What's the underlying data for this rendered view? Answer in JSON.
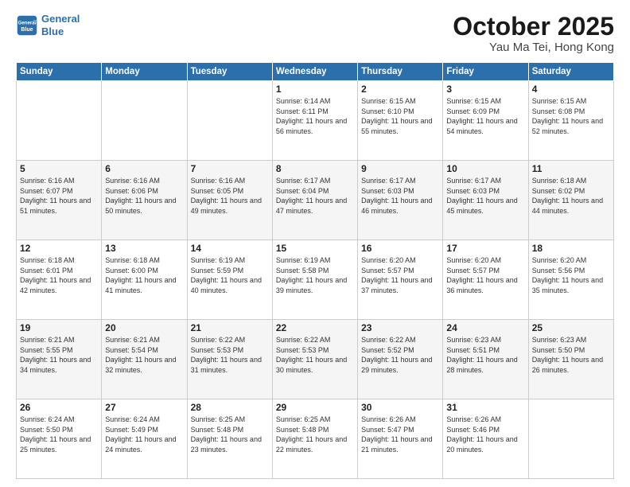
{
  "header": {
    "logo_line1": "General",
    "logo_line2": "Blue",
    "month": "October 2025",
    "location": "Yau Ma Tei, Hong Kong"
  },
  "weekdays": [
    "Sunday",
    "Monday",
    "Tuesday",
    "Wednesday",
    "Thursday",
    "Friday",
    "Saturday"
  ],
  "weeks": [
    [
      {
        "day": "",
        "sunrise": "",
        "sunset": "",
        "daylight": ""
      },
      {
        "day": "",
        "sunrise": "",
        "sunset": "",
        "daylight": ""
      },
      {
        "day": "",
        "sunrise": "",
        "sunset": "",
        "daylight": ""
      },
      {
        "day": "1",
        "sunrise": "Sunrise: 6:14 AM",
        "sunset": "Sunset: 6:11 PM",
        "daylight": "Daylight: 11 hours and 56 minutes."
      },
      {
        "day": "2",
        "sunrise": "Sunrise: 6:15 AM",
        "sunset": "Sunset: 6:10 PM",
        "daylight": "Daylight: 11 hours and 55 minutes."
      },
      {
        "day": "3",
        "sunrise": "Sunrise: 6:15 AM",
        "sunset": "Sunset: 6:09 PM",
        "daylight": "Daylight: 11 hours and 54 minutes."
      },
      {
        "day": "4",
        "sunrise": "Sunrise: 6:15 AM",
        "sunset": "Sunset: 6:08 PM",
        "daylight": "Daylight: 11 hours and 52 minutes."
      }
    ],
    [
      {
        "day": "5",
        "sunrise": "Sunrise: 6:16 AM",
        "sunset": "Sunset: 6:07 PM",
        "daylight": "Daylight: 11 hours and 51 minutes."
      },
      {
        "day": "6",
        "sunrise": "Sunrise: 6:16 AM",
        "sunset": "Sunset: 6:06 PM",
        "daylight": "Daylight: 11 hours and 50 minutes."
      },
      {
        "day": "7",
        "sunrise": "Sunrise: 6:16 AM",
        "sunset": "Sunset: 6:05 PM",
        "daylight": "Daylight: 11 hours and 49 minutes."
      },
      {
        "day": "8",
        "sunrise": "Sunrise: 6:17 AM",
        "sunset": "Sunset: 6:04 PM",
        "daylight": "Daylight: 11 hours and 47 minutes."
      },
      {
        "day": "9",
        "sunrise": "Sunrise: 6:17 AM",
        "sunset": "Sunset: 6:03 PM",
        "daylight": "Daylight: 11 hours and 46 minutes."
      },
      {
        "day": "10",
        "sunrise": "Sunrise: 6:17 AM",
        "sunset": "Sunset: 6:03 PM",
        "daylight": "Daylight: 11 hours and 45 minutes."
      },
      {
        "day": "11",
        "sunrise": "Sunrise: 6:18 AM",
        "sunset": "Sunset: 6:02 PM",
        "daylight": "Daylight: 11 hours and 44 minutes."
      }
    ],
    [
      {
        "day": "12",
        "sunrise": "Sunrise: 6:18 AM",
        "sunset": "Sunset: 6:01 PM",
        "daylight": "Daylight: 11 hours and 42 minutes."
      },
      {
        "day": "13",
        "sunrise": "Sunrise: 6:18 AM",
        "sunset": "Sunset: 6:00 PM",
        "daylight": "Daylight: 11 hours and 41 minutes."
      },
      {
        "day": "14",
        "sunrise": "Sunrise: 6:19 AM",
        "sunset": "Sunset: 5:59 PM",
        "daylight": "Daylight: 11 hours and 40 minutes."
      },
      {
        "day": "15",
        "sunrise": "Sunrise: 6:19 AM",
        "sunset": "Sunset: 5:58 PM",
        "daylight": "Daylight: 11 hours and 39 minutes."
      },
      {
        "day": "16",
        "sunrise": "Sunrise: 6:20 AM",
        "sunset": "Sunset: 5:57 PM",
        "daylight": "Daylight: 11 hours and 37 minutes."
      },
      {
        "day": "17",
        "sunrise": "Sunrise: 6:20 AM",
        "sunset": "Sunset: 5:57 PM",
        "daylight": "Daylight: 11 hours and 36 minutes."
      },
      {
        "day": "18",
        "sunrise": "Sunrise: 6:20 AM",
        "sunset": "Sunset: 5:56 PM",
        "daylight": "Daylight: 11 hours and 35 minutes."
      }
    ],
    [
      {
        "day": "19",
        "sunrise": "Sunrise: 6:21 AM",
        "sunset": "Sunset: 5:55 PM",
        "daylight": "Daylight: 11 hours and 34 minutes."
      },
      {
        "day": "20",
        "sunrise": "Sunrise: 6:21 AM",
        "sunset": "Sunset: 5:54 PM",
        "daylight": "Daylight: 11 hours and 32 minutes."
      },
      {
        "day": "21",
        "sunrise": "Sunrise: 6:22 AM",
        "sunset": "Sunset: 5:53 PM",
        "daylight": "Daylight: 11 hours and 31 minutes."
      },
      {
        "day": "22",
        "sunrise": "Sunrise: 6:22 AM",
        "sunset": "Sunset: 5:53 PM",
        "daylight": "Daylight: 11 hours and 30 minutes."
      },
      {
        "day": "23",
        "sunrise": "Sunrise: 6:22 AM",
        "sunset": "Sunset: 5:52 PM",
        "daylight": "Daylight: 11 hours and 29 minutes."
      },
      {
        "day": "24",
        "sunrise": "Sunrise: 6:23 AM",
        "sunset": "Sunset: 5:51 PM",
        "daylight": "Daylight: 11 hours and 28 minutes."
      },
      {
        "day": "25",
        "sunrise": "Sunrise: 6:23 AM",
        "sunset": "Sunset: 5:50 PM",
        "daylight": "Daylight: 11 hours and 26 minutes."
      }
    ],
    [
      {
        "day": "26",
        "sunrise": "Sunrise: 6:24 AM",
        "sunset": "Sunset: 5:50 PM",
        "daylight": "Daylight: 11 hours and 25 minutes."
      },
      {
        "day": "27",
        "sunrise": "Sunrise: 6:24 AM",
        "sunset": "Sunset: 5:49 PM",
        "daylight": "Daylight: 11 hours and 24 minutes."
      },
      {
        "day": "28",
        "sunrise": "Sunrise: 6:25 AM",
        "sunset": "Sunset: 5:48 PM",
        "daylight": "Daylight: 11 hours and 23 minutes."
      },
      {
        "day": "29",
        "sunrise": "Sunrise: 6:25 AM",
        "sunset": "Sunset: 5:48 PM",
        "daylight": "Daylight: 11 hours and 22 minutes."
      },
      {
        "day": "30",
        "sunrise": "Sunrise: 6:26 AM",
        "sunset": "Sunset: 5:47 PM",
        "daylight": "Daylight: 11 hours and 21 minutes."
      },
      {
        "day": "31",
        "sunrise": "Sunrise: 6:26 AM",
        "sunset": "Sunset: 5:46 PM",
        "daylight": "Daylight: 11 hours and 20 minutes."
      },
      {
        "day": "",
        "sunrise": "",
        "sunset": "",
        "daylight": ""
      }
    ]
  ]
}
